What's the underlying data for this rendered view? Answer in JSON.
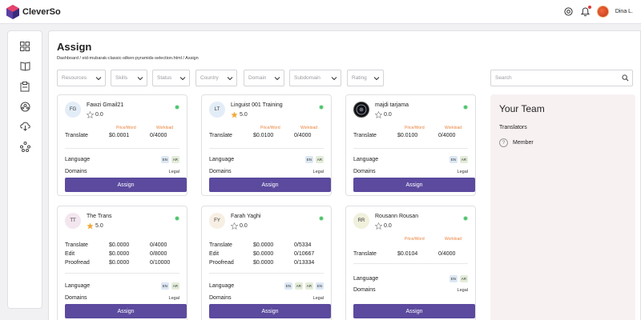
{
  "app": {
    "name": "CleverSo"
  },
  "user": {
    "name": "Dina L."
  },
  "page": {
    "title": "Assign",
    "breadcrumb": "Dashboard / eid-mubarak-classic-silken-pyramids-selection.html / Assign"
  },
  "filters": {
    "resources": "Resources",
    "skills": "Skills",
    "status": "Status",
    "country": "Country",
    "domain": "Domain",
    "subdomain": "Subdomain",
    "rating": "Rating"
  },
  "search": {
    "placeholder": "Search"
  },
  "labels": {
    "price_word": "Price/Word",
    "workload": "Workload",
    "language": "Language",
    "domains": "Domains",
    "assign": "Assign"
  },
  "cards": [
    {
      "initials": "FG",
      "name": "Fawzi Gmail21",
      "rating": "0.0",
      "rated": false,
      "status_color": "#4cc36a",
      "rows": [
        {
          "label": "Translate",
          "price": "$0.0001",
          "workload": "0/4000"
        }
      ],
      "languages": [
        "EN",
        "AR"
      ],
      "domain": "Legal"
    },
    {
      "initials": "LT",
      "name": "Linguist 001 Training",
      "rating": "5.0",
      "rated": true,
      "status_color": "#4cc36a",
      "rows": [
        {
          "label": "Translate",
          "price": "$0.0100",
          "workload": "0/4000"
        }
      ],
      "languages": [
        "EN",
        "AR"
      ],
      "domain": "Legal"
    },
    {
      "initials": "",
      "name": "majdi tarjama",
      "rating": "0.0",
      "rated": false,
      "status_color": "#4cc36a",
      "rows": [
        {
          "label": "Translate",
          "price": "$0.0100",
          "workload": "0/4000"
        }
      ],
      "languages": [
        "EN",
        "AR"
      ],
      "domain": "Legal"
    },
    {
      "initials": "TT",
      "name": "The Trans",
      "rating": "5.0",
      "rated": true,
      "status_color": "#4cc36a",
      "rows": [
        {
          "label": "Translate",
          "price": "$0.0000",
          "workload": "0/4000"
        },
        {
          "label": "Edit",
          "price": "$0.0000",
          "workload": "0/8000"
        },
        {
          "label": "Proofread",
          "price": "$0.0000",
          "workload": "0/10000"
        }
      ],
      "languages": [
        "EN",
        "AR"
      ],
      "domain": "Legal"
    },
    {
      "initials": "FY",
      "name": "Farah Yaghi",
      "rating": "0.0",
      "rated": false,
      "status_color": "#4cc36a",
      "rows": [
        {
          "label": "Translate",
          "price": "$0.0000",
          "workload": "0/5334"
        },
        {
          "label": "Edit",
          "price": "$0.0000",
          "workload": "0/10667"
        },
        {
          "label": "Proofread",
          "price": "$0.0000",
          "workload": "0/13334"
        }
      ],
      "languages": [
        "EN",
        "AR",
        "AR",
        "EN"
      ],
      "domain": "Legal"
    },
    {
      "initials": "RR",
      "name": "Rousann Rousan",
      "rating": "0.0",
      "rated": false,
      "status_color": "#4cc36a",
      "rows": [
        {
          "label": "Translate",
          "price": "$0.0104",
          "workload": "0/4000"
        }
      ],
      "languages": [
        "EN",
        "AR"
      ],
      "domain": "Legal"
    }
  ],
  "team": {
    "title": "Your Team",
    "subtitle": "Translators",
    "member": "Member"
  },
  "colors": {
    "accent": "#5b4a9e",
    "online": "#4cc36a",
    "label_orange": "#e9803a",
    "star": "#f2a93b"
  }
}
